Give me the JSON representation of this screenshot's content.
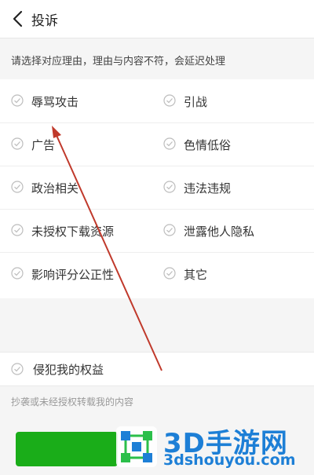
{
  "header": {
    "title": "投诉"
  },
  "notice": "请选择对应理由，理由与内容不符，会延迟处理",
  "reasons": [
    [
      "辱骂攻击",
      "引战"
    ],
    [
      "广告",
      "色情低俗"
    ],
    [
      "政治相关",
      "违法违规"
    ],
    [
      "未授权下载资源",
      "泄露他人隐私"
    ],
    [
      "影响评分公正性",
      "其它"
    ]
  ],
  "self_reason": "侵犯我的权益",
  "self_hint": "抄袭或未经授权转载我的内容",
  "watermark": {
    "title": "3D手游网",
    "url": "3dshouyou.com"
  },
  "colors": {
    "submit": "#1aad19",
    "watermark": "#1d7fd6",
    "arrow": "#c0392b"
  }
}
